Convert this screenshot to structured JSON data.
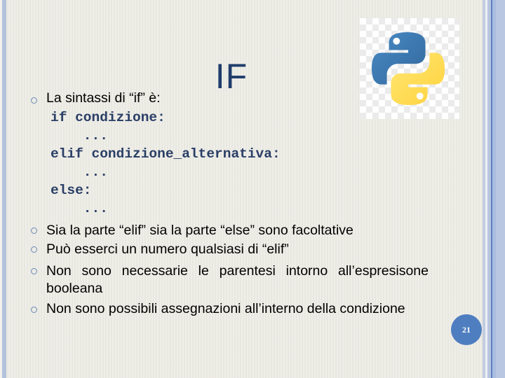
{
  "slide": {
    "title": "IF",
    "page_number": "21",
    "logo": "python-logo",
    "colors": {
      "title": "#1f3d6b",
      "code": "#2a3e66",
      "accent": "#4e7ec0",
      "bullet": "#6b8ab4",
      "background": "#ecebe4"
    }
  },
  "bullets": [
    {
      "text": "La sintassi di “if” è:"
    },
    {
      "text": "Sia la parte “elif” sia la parte “else” sono facoltative"
    },
    {
      "text": "Può esserci un numero qualsiasi di “elif”"
    },
    {
      "text": "Non sono necessarie le parentesi intorno all’espresisone booleana"
    },
    {
      "text": "Non sono possibili assegnazioni all’interno della condizione"
    }
  ],
  "code": [
    "if condizione:",
    "    ...",
    "elif condizione_alternativa:",
    "    ...",
    "else:",
    "    ..."
  ]
}
